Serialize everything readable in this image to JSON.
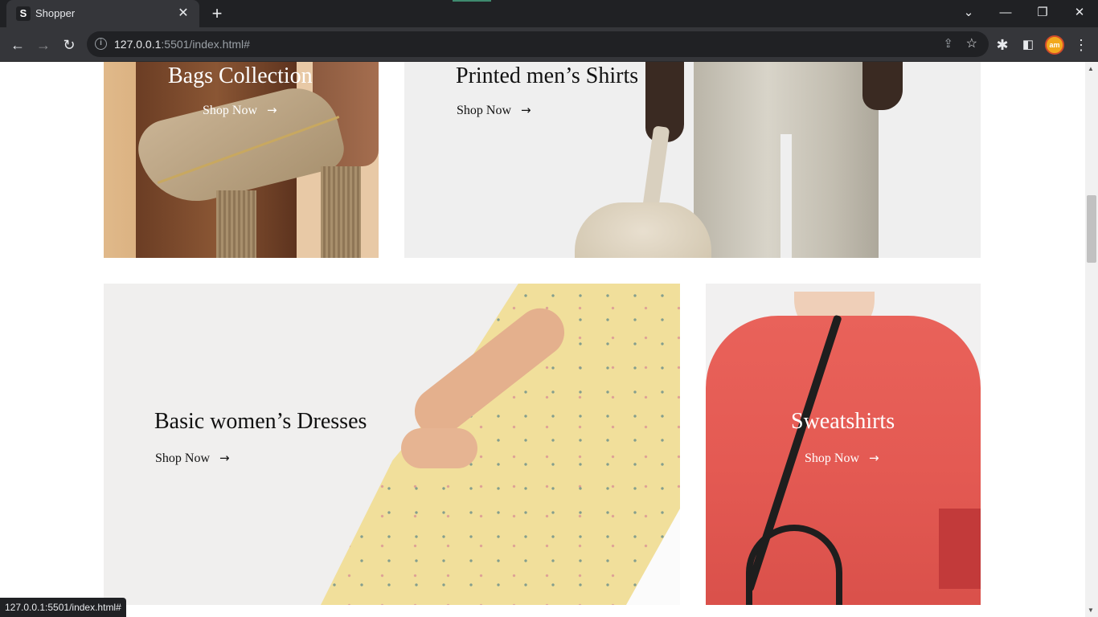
{
  "browser": {
    "tab": {
      "favicon_letter": "S",
      "title": "Shopper",
      "close_glyph": "✕"
    },
    "new_tab_glyph": "+",
    "window_controls": {
      "dropdown": "⌄",
      "minimize": "—",
      "restore": "❐",
      "close": "✕"
    },
    "nav": {
      "back": "←",
      "forward": "→",
      "reload": "↻"
    },
    "address": {
      "host": "127.0.0.1",
      "rest": ":5501/index.html#"
    },
    "profile_initials": "am",
    "status_url": "127.0.0.1:5501/index.html#"
  },
  "page": {
    "cards": [
      {
        "id": "bags",
        "title": "Bags Collection",
        "cta": "Shop Now",
        "text_color": "#ffffff"
      },
      {
        "id": "shirts",
        "title": "Printed men’s Shirts",
        "cta": "Shop Now",
        "text_color": "#111111"
      },
      {
        "id": "dresses",
        "title": "Basic women’s Dresses",
        "cta": "Shop Now",
        "text_color": "#111111"
      },
      {
        "id": "sweatshirts",
        "title": "Sweatshirts",
        "cta": "Shop Now",
        "text_color": "#ffffff"
      }
    ],
    "arrow_glyph": "→"
  },
  "icons": [
    "info-icon",
    "share-icon",
    "star-icon",
    "extensions-icon",
    "side-panel-icon",
    "menu-icon",
    "arrow-right-icon"
  ]
}
